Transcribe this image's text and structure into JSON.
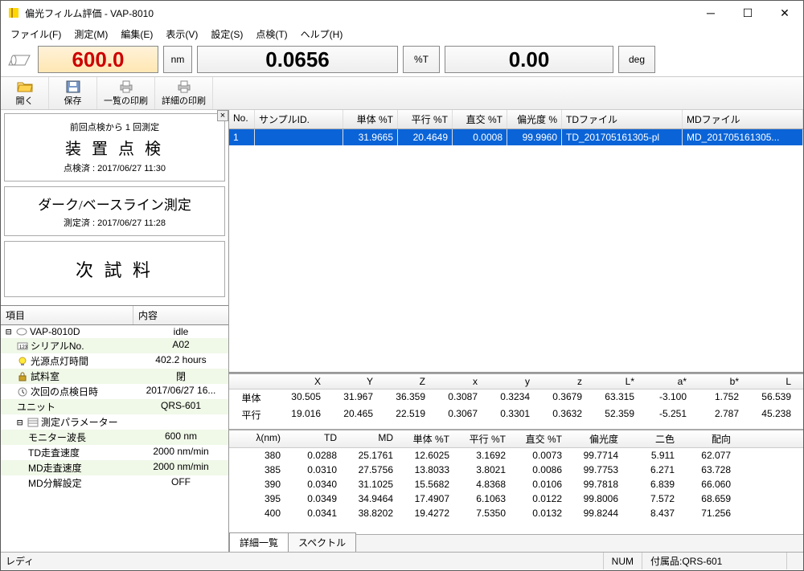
{
  "window": {
    "title": "偏光フィルム評価 - VAP-8010"
  },
  "menu": {
    "file": "ファイル(F)",
    "measure": "測定(M)",
    "edit": "編集(E)",
    "view": "表示(V)",
    "settings": "設定(S)",
    "inspect": "点検(T)",
    "help": "ヘルプ(H)"
  },
  "readout": {
    "wavelength": "600.0",
    "wl_unit": "nm",
    "transmittance": "0.0656",
    "t_unit": "%T",
    "angle": "0.00",
    "angle_unit": "deg"
  },
  "toolbar": {
    "open": "開く",
    "save": "保存",
    "print_list": "一覧の印刷",
    "print_detail": "詳細の印刷"
  },
  "wizard": {
    "step1": {
      "sub": "前回点検から 1 回測定",
      "main": "装 置 点 検",
      "sub2": "点検済 : 2017/06/27 11:30"
    },
    "step2": {
      "main": "ダーク/ベースライン測定",
      "sub2": "測定済 : 2017/06/27 11:28"
    },
    "step3": {
      "main": "次 試 料"
    }
  },
  "props": {
    "head": {
      "c1": "項目",
      "c2": "内容"
    },
    "rows": [
      {
        "toggle": "⊟",
        "icon": "device",
        "label": "VAP-8010D",
        "value": "idle",
        "even": false
      },
      {
        "ind": 1,
        "icon": "serial",
        "label": "シリアルNo.",
        "value": "A02",
        "even": true
      },
      {
        "ind": 1,
        "icon": "lamp",
        "label": "光源点灯時間",
        "value": "402.2 hours",
        "even": false
      },
      {
        "ind": 1,
        "icon": "lock",
        "label": "試料室",
        "value": "閉",
        "even": true
      },
      {
        "ind": 1,
        "icon": "clock",
        "label": "次回の点検日時",
        "value": "2017/06/27 16...",
        "even": false
      },
      {
        "ind": 1,
        "icon": "",
        "label": "ユニット",
        "value": "QRS-601",
        "even": true
      },
      {
        "toggle": "⊟",
        "ind": 1,
        "icon": "params",
        "label": "測定パラメーター",
        "value": "",
        "even": false
      },
      {
        "ind": 2,
        "icon": "",
        "label": "モニター波長",
        "value": "600 nm",
        "even": true
      },
      {
        "ind": 2,
        "icon": "",
        "label": "TD走査速度",
        "value": "2000 nm/min",
        "even": false
      },
      {
        "ind": 2,
        "icon": "",
        "label": "MD走査速度",
        "value": "2000 nm/min",
        "even": true
      },
      {
        "ind": 2,
        "icon": "",
        "label": "MD分解設定",
        "value": "OFF",
        "even": false
      }
    ]
  },
  "uppergrid": {
    "head": [
      "No.",
      "サンプルID.",
      "単体 %T",
      "平行 %T",
      "直交 %T",
      "偏光度 %",
      "TDファイル",
      "MDファイル"
    ],
    "row": [
      "1",
      "",
      "31.9665",
      "20.4649",
      "0.0008",
      "99.9960",
      "TD_201705161305-pl",
      "MD_201705161305..."
    ]
  },
  "colorgrid": {
    "head": [
      "",
      "X",
      "Y",
      "Z",
      "x",
      "y",
      "z",
      "L*",
      "a*",
      "b*",
      "L"
    ],
    "rows": [
      [
        "単体",
        "30.505",
        "31.967",
        "36.359",
        "0.3087",
        "0.3234",
        "0.3679",
        "63.315",
        "-3.100",
        "1.752",
        "56.539"
      ],
      [
        "平行",
        "19.016",
        "20.465",
        "22.519",
        "0.3067",
        "0.3301",
        "0.3632",
        "52.359",
        "-5.251",
        "2.787",
        "45.238"
      ]
    ]
  },
  "specgrid": {
    "head": [
      "λ(nm)",
      "TD",
      "MD",
      "単体 %T",
      "平行 %T",
      "直交 %T",
      "偏光度",
      "二色",
      "配向"
    ],
    "rows": [
      [
        "380",
        "0.0288",
        "25.1761",
        "12.6025",
        "3.1692",
        "0.0073",
        "99.7714",
        "5.911",
        "62.077"
      ],
      [
        "385",
        "0.0310",
        "27.5756",
        "13.8033",
        "3.8021",
        "0.0086",
        "99.7753",
        "6.271",
        "63.728"
      ],
      [
        "390",
        "0.0340",
        "31.1025",
        "15.5682",
        "4.8368",
        "0.0106",
        "99.7818",
        "6.839",
        "66.060"
      ],
      [
        "395",
        "0.0349",
        "34.9464",
        "17.4907",
        "6.1063",
        "0.0122",
        "99.8006",
        "7.572",
        "68.659"
      ],
      [
        "400",
        "0.0341",
        "38.8202",
        "19.4272",
        "7.5350",
        "0.0132",
        "99.8244",
        "8.437",
        "71.256"
      ]
    ]
  },
  "tabs": {
    "detail": "詳細一覧",
    "spectrum": "スペクトル"
  },
  "status": {
    "ready": "レディ",
    "num": "NUM",
    "accessory": "付属品:QRS-601"
  }
}
